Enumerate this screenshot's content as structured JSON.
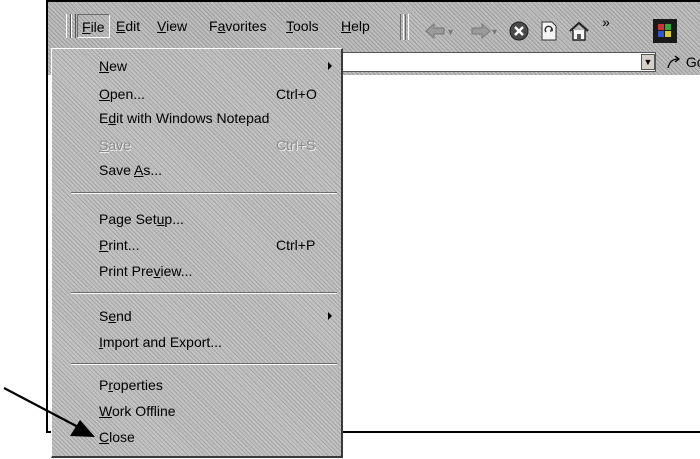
{
  "menubar": {
    "items": [
      {
        "pre": "",
        "key": "F",
        "post": "ile"
      },
      {
        "pre": "",
        "key": "E",
        "post": "dit"
      },
      {
        "pre": "",
        "key": "V",
        "post": "iew"
      },
      {
        "pre": "F",
        "key": "a",
        "post": "vorites"
      },
      {
        "pre": "",
        "key": "T",
        "post": "ools"
      },
      {
        "pre": "",
        "key": "H",
        "post": "elp"
      }
    ]
  },
  "toolbar": {
    "icons": [
      "back-arrow-icon",
      "forward-arrow-icon",
      "stop-icon",
      "refresh-icon",
      "home-icon",
      "chevron-more-icon",
      "windows-logo-icon"
    ],
    "more_glyph": "»"
  },
  "address_bar": {
    "value": "",
    "go_label": "Go"
  },
  "file_menu": {
    "items": [
      {
        "pre": "",
        "key": "N",
        "post": "ew",
        "shortcut": "",
        "submenu": true,
        "enabled": true
      },
      {
        "pre": "",
        "key": "O",
        "post": "pen...",
        "shortcut": "Ctrl+O",
        "submenu": false,
        "enabled": true
      },
      {
        "pre": "E",
        "key": "d",
        "post": "it with Windows Notepad",
        "shortcut": "",
        "submenu": false,
        "enabled": true
      },
      {
        "pre": "",
        "key": "S",
        "post": "ave",
        "shortcut": "Ctrl+S",
        "submenu": false,
        "enabled": false
      },
      {
        "pre": "Save ",
        "key": "A",
        "post": "s...",
        "shortcut": "",
        "submenu": false,
        "enabled": true
      },
      {
        "pre": "Page Set",
        "key": "u",
        "post": "p...",
        "shortcut": "",
        "submenu": false,
        "enabled": true
      },
      {
        "pre": "",
        "key": "P",
        "post": "rint...",
        "shortcut": "Ctrl+P",
        "submenu": false,
        "enabled": true
      },
      {
        "pre": "Print Pre",
        "key": "v",
        "post": "iew...",
        "shortcut": "",
        "submenu": false,
        "enabled": true
      },
      {
        "pre": "S",
        "key": "e",
        "post": "nd",
        "shortcut": "",
        "submenu": true,
        "enabled": true
      },
      {
        "pre": "",
        "key": "I",
        "post": "mport and Export...",
        "shortcut": "",
        "submenu": false,
        "enabled": true
      },
      {
        "pre": "P",
        "key": "r",
        "post": "operties",
        "shortcut": "",
        "submenu": false,
        "enabled": true
      },
      {
        "pre": "",
        "key": "W",
        "post": "ork Offline",
        "shortcut": "",
        "submenu": false,
        "enabled": true
      },
      {
        "pre": "",
        "key": "C",
        "post": "lose",
        "shortcut": "",
        "submenu": false,
        "enabled": true
      }
    ]
  },
  "colors": {
    "chrome": "#bdbdbd",
    "menu_bg": "#c2c2c2",
    "disabled_text": "#8a8a8a",
    "content_bg": "#ffffff"
  }
}
